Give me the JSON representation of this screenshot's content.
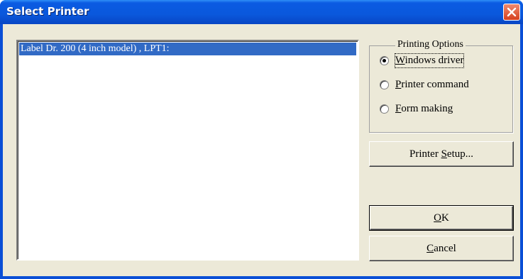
{
  "window": {
    "title": "Select Printer"
  },
  "printer_list": {
    "items": [
      {
        "label": "Label Dr. 200 (4 inch model) , LPT1:",
        "selected": true
      }
    ]
  },
  "printing_options": {
    "group_title": "Printing Options",
    "options": [
      {
        "mnemonic": "W",
        "rest": "indows driver",
        "checked": true
      },
      {
        "mnemonic": "P",
        "rest": "rinter command",
        "checked": false
      },
      {
        "mnemonic": "F",
        "rest": "orm making",
        "checked": false
      }
    ]
  },
  "buttons": {
    "printer_setup": {
      "before": "Printer ",
      "mnemonic": "S",
      "after": "etup..."
    },
    "ok": {
      "mnemonic": "O",
      "after": "K"
    },
    "cancel": {
      "mnemonic": "C",
      "after": "ancel"
    }
  },
  "colors": {
    "titlebar": "#0a58dc",
    "selection": "#316ac5",
    "dialog_face": "#ece9d8",
    "close_button": "#d5401e"
  },
  "icons": {
    "close": "close-icon"
  }
}
